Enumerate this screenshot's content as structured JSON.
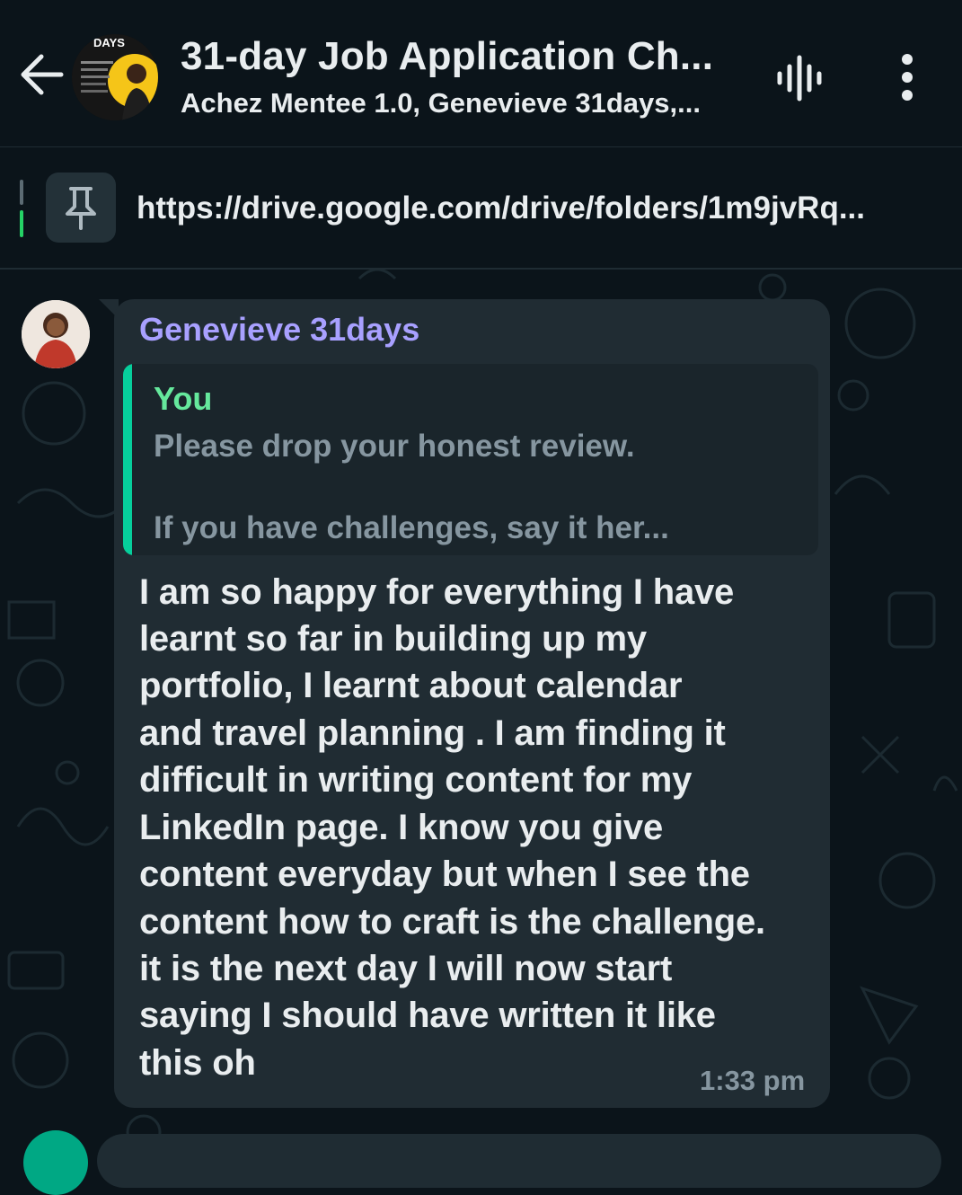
{
  "header": {
    "title": "31-day Job Application Ch...",
    "subtitle": "Achez Mentee 1.0, Genevieve 31days,...",
    "avatar_text": "DAYS"
  },
  "pinned": {
    "text": "https://drive.google.com/drive/folders/1m9jvRq..."
  },
  "message": {
    "sender": "Genevieve 31days",
    "quote": {
      "author": "You",
      "line1": "Please drop your honest review.",
      "line2": "If you have challenges, say it her..."
    },
    "lines": [
      "I am so happy for everything I have",
      "learnt so far in  building up my",
      "portfolio, I learnt about calendar",
      "and travel planning . I am finding it",
      "difficult  in writing content for  my",
      "LinkedIn page. I know you give",
      "content everyday but when I see the",
      "content how to craft is the challenge.",
      "it is the next day I will now start",
      "saying I should have written it like",
      "this oh"
    ],
    "time": "1:33 pm"
  },
  "colors": {
    "background": "#0b141a",
    "bubble": "#202c33",
    "sender_name": "#a8a0ff",
    "quote_author": "#65e89c",
    "quote_bar": "#06cf9c",
    "accent": "#00a884"
  },
  "icons": [
    "back-arrow-icon",
    "voice-call-icon",
    "more-options-icon",
    "pin-icon"
  ]
}
